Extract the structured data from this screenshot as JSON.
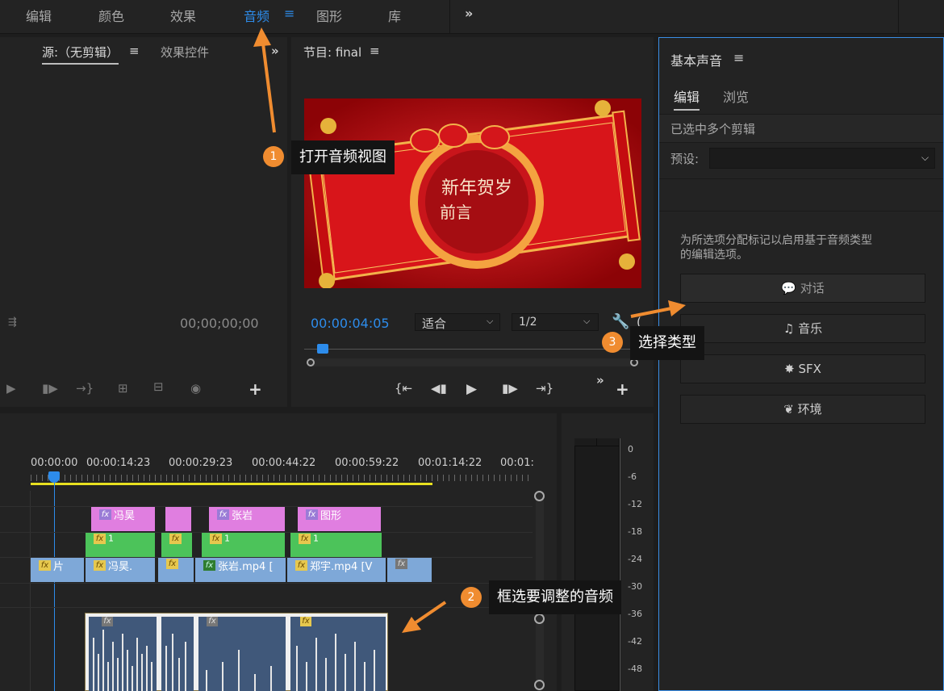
{
  "workspace_tabs": [
    {
      "label": "编辑"
    },
    {
      "label": "颜色"
    },
    {
      "label": "效果"
    },
    {
      "label": "音频"
    },
    {
      "label": "图形"
    },
    {
      "label": "库"
    }
  ],
  "source_panel": {
    "title": "源:（无剪辑）",
    "tab2": "效果控件",
    "timecode": "00;00;00;00"
  },
  "program_panel": {
    "title": "节目: final",
    "timecode": "00:00:04:05",
    "fit": "适合",
    "resolution": "1/2",
    "preview_text_1": "新年贺岁",
    "preview_text_2": "前言"
  },
  "timeline": {
    "ruler": [
      "00:00:00",
      "00:00:14:23",
      "00:00:29:23",
      "00:00:44:22",
      "00:00:59:22",
      "00:01:14:22",
      "00:01:"
    ],
    "v3_clips": [
      "冯昊",
      "",
      "张岩",
      "图形"
    ],
    "v2_clips": [
      "1",
      "",
      "1",
      "1"
    ],
    "v1_clips": [
      "片",
      "冯昊.",
      "",
      "张岩.mp4 [",
      "郑宇.mp4 [V",
      ""
    ]
  },
  "meter": {
    "db_labels": [
      "0",
      "-6",
      "-12",
      "-18",
      "-24",
      "-30",
      "-36",
      "-42",
      "-48"
    ]
  },
  "essential_sound": {
    "title": "基本声音",
    "tabs": [
      "编辑",
      "浏览"
    ],
    "status": "已选中多个剪辑",
    "preset_label": "预设:",
    "hint_line1": "为所选项分配标记以启用基于音频类型",
    "hint_line2": "的编辑选项。",
    "buttons": [
      "对话",
      "音乐",
      "SFX",
      "环境"
    ]
  },
  "annotations": [
    {
      "number": "1",
      "text": "打开音频视图"
    },
    {
      "number": "2",
      "text": "框选要调整的音频"
    },
    {
      "number": "3",
      "text": "选择类型"
    }
  ],
  "colors": {
    "accent_blue": "#2d8ceb",
    "annotation_orange": "#f08c30",
    "clip_pink": "#e07ee0",
    "clip_green": "#4cc35a",
    "clip_blue": "#7ea8d8"
  }
}
